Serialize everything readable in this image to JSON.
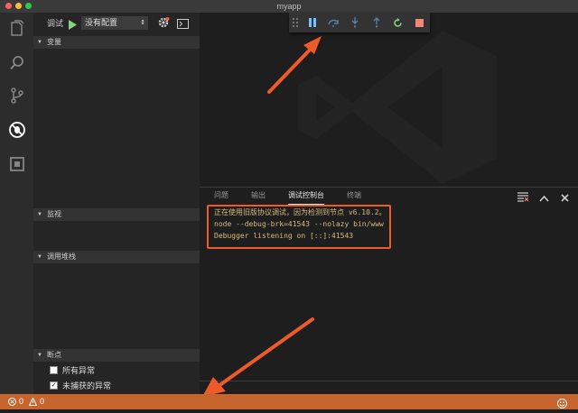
{
  "window": {
    "title": "myapp"
  },
  "activity_bar": {
    "items": [
      "files-icon",
      "search-icon",
      "source-control-icon",
      "debug-icon",
      "extensions-icon"
    ]
  },
  "debug_toolbar": {
    "label": "调试",
    "config": "没有配置"
  },
  "sidebar": {
    "variables_title": "变量",
    "watch_title": "监视",
    "callstack_title": "调用堆栈",
    "breakpoints_title": "断点",
    "breakpoints": [
      {
        "label": "所有异常",
        "checked": false
      },
      {
        "label": "未捕获的异常",
        "checked": true
      }
    ]
  },
  "panel": {
    "tabs": [
      "问题",
      "输出",
      "调试控制台",
      "终端"
    ],
    "active_tab": "调试控制台",
    "console_lines": [
      "正在使用旧版协议调试，因为检测到节点 v6.10.2。",
      "node --debug-brk=41543 --nolazy bin/www",
      "Debugger listening on [::]:41543"
    ]
  },
  "statusbar": {
    "errors": "0",
    "warnings": "0"
  },
  "colors": {
    "accent_orange": "#c7652f",
    "annotation_red": "#ee5a2a",
    "console_text": "#d7ba7d"
  }
}
